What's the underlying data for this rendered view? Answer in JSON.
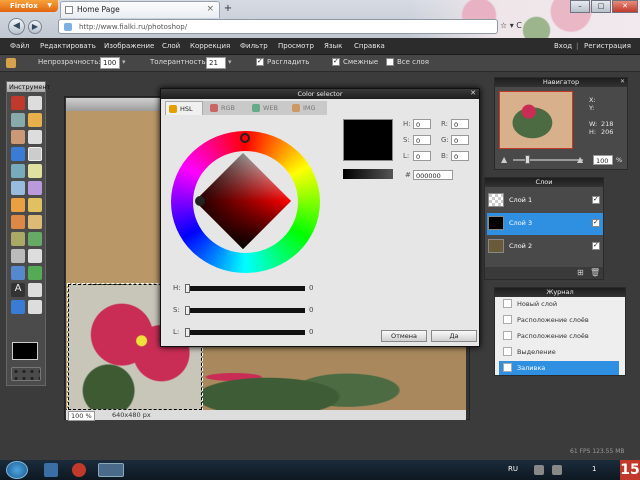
{
  "browser": {
    "menu_button": "Firefox",
    "tab_title": "Home Page",
    "new_tab": "+",
    "url": "http://www.fialki.ru/photoshop/"
  },
  "menubar": {
    "items": [
      "Файл",
      "Редактировать",
      "Изображение",
      "Слой",
      "Коррекция",
      "Фильтр",
      "Просмотр",
      "Язык",
      "Справка"
    ],
    "login": "Вход",
    "register": "Регистрация"
  },
  "options": {
    "opacity_label": "Непрозрачность:",
    "opacity_value": "100",
    "tolerance_label": "Толерантность:",
    "tolerance_value": "21",
    "antialias_label": "Расгладить",
    "contiguous_label": "Смежные",
    "all_layers_label": "Все слоя"
  },
  "toolbox": {
    "title": "Инструмент"
  },
  "canvas": {
    "zoom": "100 %",
    "size": "640x480 px"
  },
  "dialog": {
    "title": "Color selector",
    "tabs": [
      "HSL",
      "RGB",
      "WEB",
      "IMG"
    ],
    "sliders": [
      {
        "label": "H:",
        "value": "0"
      },
      {
        "label": "S:",
        "value": "0"
      },
      {
        "label": "L:",
        "value": "0"
      }
    ],
    "fields_left": [
      {
        "label": "H:",
        "value": "0"
      },
      {
        "label": "S:",
        "value": "0"
      },
      {
        "label": "L:",
        "value": "0"
      }
    ],
    "fields_right": [
      {
        "label": "R:",
        "value": "0"
      },
      {
        "label": "G:",
        "value": "0"
      },
      {
        "label": "B:",
        "value": "0"
      }
    ],
    "hex_label": "#",
    "hex_value": "000000",
    "cancel": "Отмена",
    "ok": "Да"
  },
  "navigator": {
    "title": "Навигатор",
    "x_label": "X:",
    "y_label": "Y:",
    "w_label": "W:",
    "w_value": "218",
    "h_label": "H:",
    "h_value": "206",
    "zoom": "100",
    "zoom_unit": "%"
  },
  "layers": {
    "title": "Слои",
    "items": [
      {
        "name": "Слой 1",
        "selected": false
      },
      {
        "name": "Слой 3",
        "selected": true
      },
      {
        "name": "Слой 2",
        "selected": false
      }
    ]
  },
  "history": {
    "title": "Журнал",
    "items": [
      {
        "name": "Новый слой",
        "selected": false
      },
      {
        "name": "Расположение слоёв",
        "selected": false
      },
      {
        "name": "Расположение слоёв",
        "selected": false
      },
      {
        "name": "Выделение",
        "selected": false
      },
      {
        "name": "Заливка",
        "selected": true
      }
    ]
  },
  "status": {
    "fps": "61 FPS 123.55 MB"
  },
  "taskbar": {
    "lang": "RU",
    "clock": "1",
    "badge": "15"
  },
  "colors": {
    "firefox_orange": "#e0640f",
    "selection_blue": "#2f8fe0",
    "dark_ui": "#2c2c2c"
  }
}
